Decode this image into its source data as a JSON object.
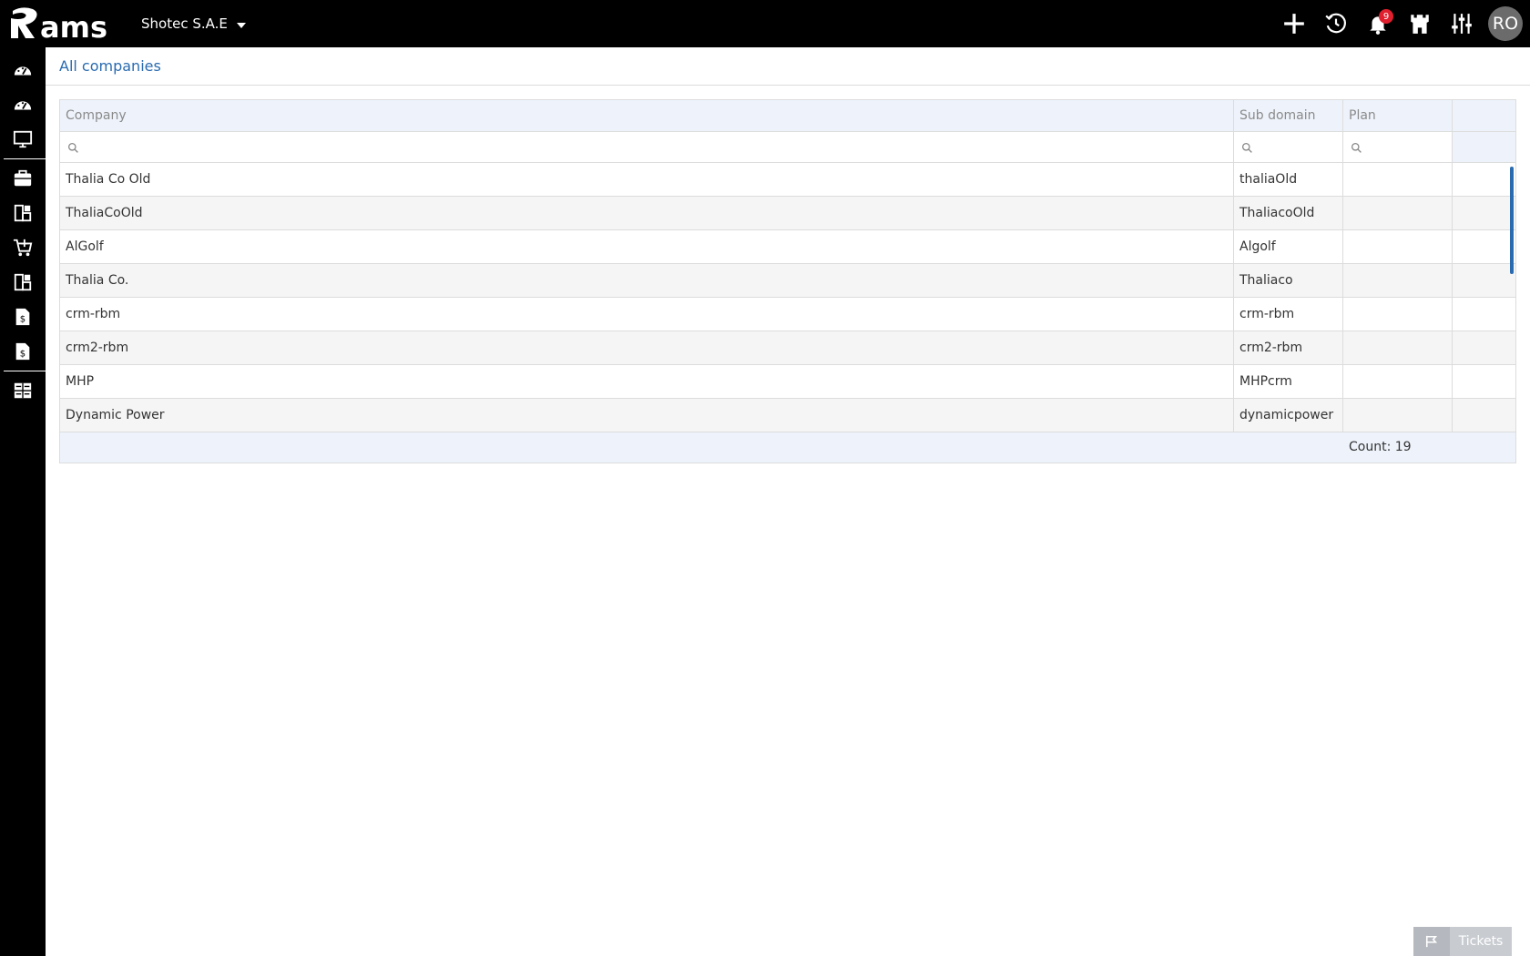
{
  "topbar": {
    "logo_text": "ams",
    "company": "Shotec S.A.E",
    "notification_count": "9",
    "avatar_initials": "RO"
  },
  "page": {
    "title": "All companies"
  },
  "grid": {
    "columns": {
      "company": "Company",
      "sub_domain": "Sub domain",
      "plan": "Plan"
    },
    "rows": [
      {
        "company": "Thalia Co Old",
        "sub_domain": "thaliaOld",
        "plan": ""
      },
      {
        "company": "ThaliaCoOld",
        "sub_domain": "ThaliacoOld",
        "plan": ""
      },
      {
        "company": "AlGolf",
        "sub_domain": "Algolf",
        "plan": ""
      },
      {
        "company": "Thalia Co.",
        "sub_domain": "Thaliaco",
        "plan": ""
      },
      {
        "company": "crm-rbm",
        "sub_domain": "crm-rbm",
        "plan": ""
      },
      {
        "company": "crm2-rbm",
        "sub_domain": "crm2-rbm",
        "plan": ""
      },
      {
        "company": "MHP",
        "sub_domain": "MHPcrm",
        "plan": ""
      },
      {
        "company": "Dynamic Power",
        "sub_domain": "dynamicpower",
        "plan": ""
      }
    ],
    "count_label": "Count: 19"
  },
  "tickets": {
    "label": "Tickets"
  },
  "colors": {
    "accent": "#2a6bb0",
    "header_bg": "#eef3fb",
    "badge": "#e0202e"
  }
}
